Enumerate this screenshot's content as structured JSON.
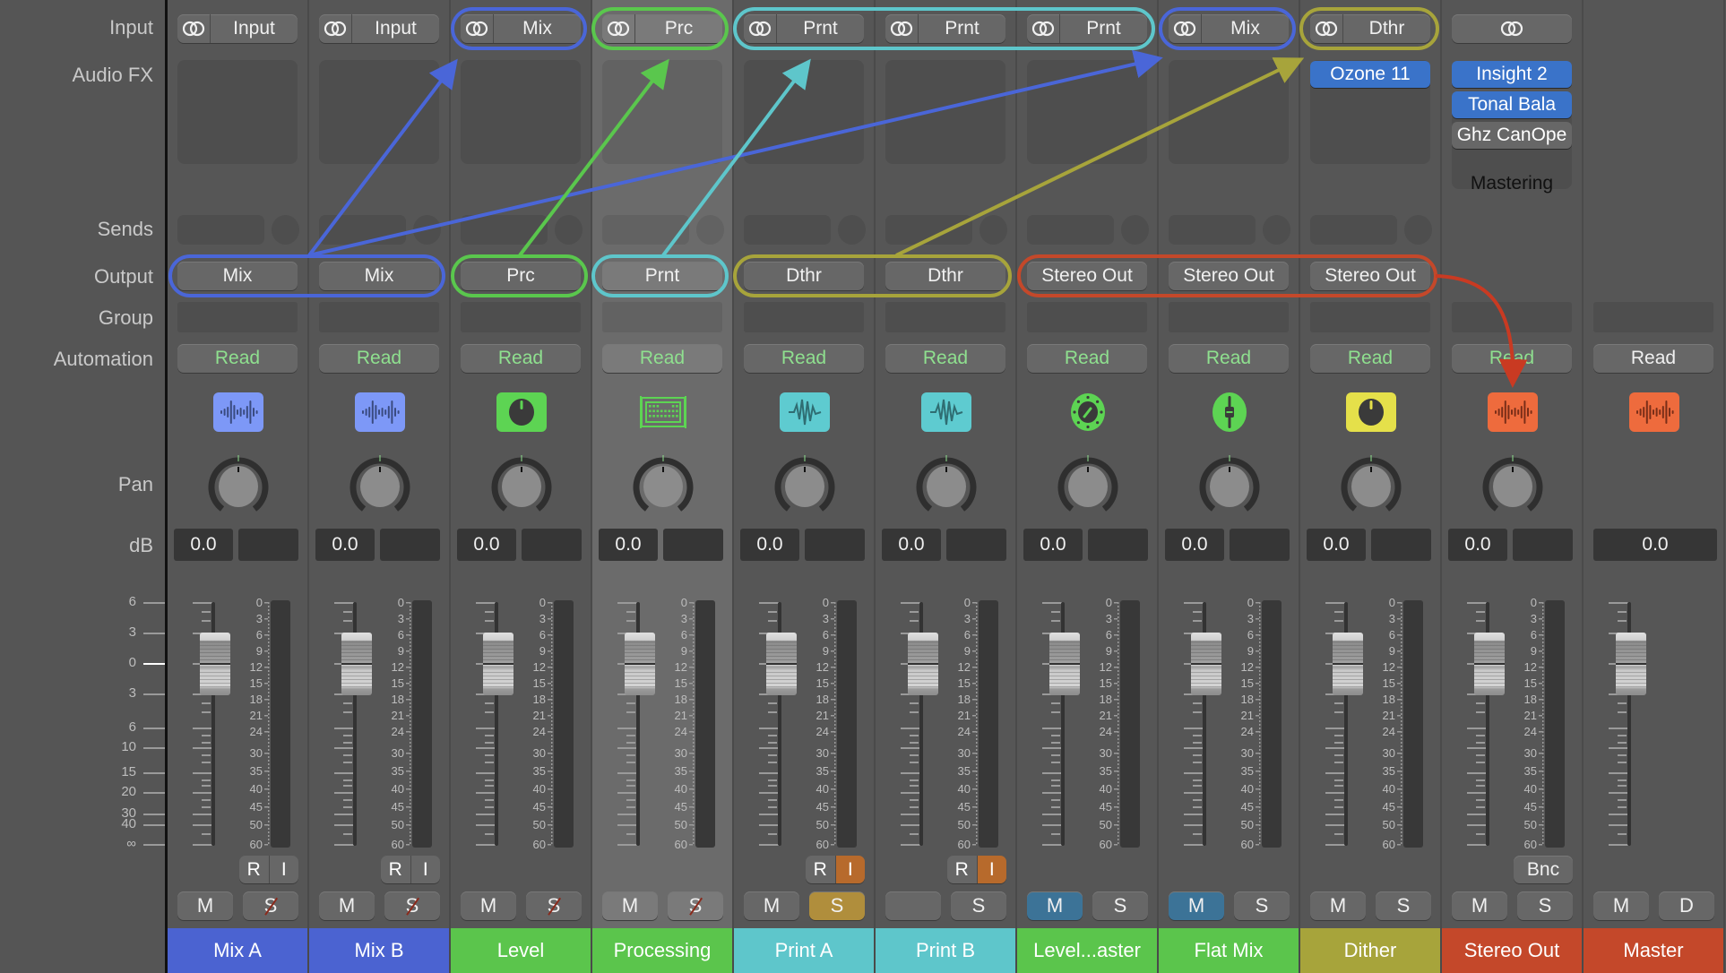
{
  "row_labels": {
    "input": "Input",
    "audio_fx": "Audio FX",
    "sends": "Sends",
    "output": "Output",
    "group": "Group",
    "automation": "Automation",
    "pan": "Pan",
    "db": "dB"
  },
  "fader_scale_left": [
    "6",
    "3",
    "0",
    "3",
    "6",
    "10",
    "15",
    "20",
    "30",
    "40",
    "∞"
  ],
  "meter_scale": [
    "0",
    "3",
    "6",
    "9",
    "12",
    "15",
    "18",
    "21",
    "24",
    "30",
    "35",
    "40",
    "45",
    "50",
    "60"
  ],
  "colors": {
    "blue": "#4a66d8",
    "green": "#5ac74d",
    "cyan": "#5ec6cb",
    "olive": "#a7a43b",
    "red": "#c4482a",
    "plugin_blue": "#3a73c9",
    "read_green": "#8fe08f",
    "mute_on": "#3c7397",
    "solo_on": "#b08e3c",
    "input_on": "#b76a2c"
  },
  "strips": [
    {
      "name": "Mix A",
      "color": "#4b63d1",
      "input": "Input",
      "output": "Mix",
      "automation": "Read",
      "icon": "waveform-icon",
      "icon_color": "#7d98f7",
      "db": "0.0",
      "ri": true,
      "i_on": false,
      "m": "M",
      "s": "S",
      "s_strike": true,
      "m_on": false,
      "s_on": false,
      "plugins": []
    },
    {
      "name": "Mix B",
      "color": "#4b63d1",
      "input": "Input",
      "output": "Mix",
      "automation": "Read",
      "icon": "waveform-icon",
      "icon_color": "#7d98f7",
      "db": "0.0",
      "ri": true,
      "i_on": false,
      "m": "M",
      "s": "S",
      "s_strike": true,
      "m_on": false,
      "s_on": false,
      "plugins": []
    },
    {
      "name": "Level",
      "color": "#5bc54c",
      "input": "Mix",
      "output": "Prc",
      "automation": "Read",
      "icon": "knob-icon",
      "icon_color": "#5dd453",
      "db": "0.0",
      "ri": false,
      "m": "M",
      "s": "S",
      "s_strike": true,
      "m_on": false,
      "s_on": false,
      "plugins": []
    },
    {
      "name": "Processing",
      "color": "#5bc54c",
      "input": "Prc",
      "output": "Prnt",
      "automation": "Read",
      "icon": "keyboard-icon",
      "icon_color": "#5dd453",
      "db": "0.0",
      "ri": false,
      "m": "M",
      "s": "S",
      "s_strike": true,
      "m_on": false,
      "s_on": false,
      "selected": true,
      "plugins": []
    },
    {
      "name": "Print A",
      "color": "#5ec6cb",
      "input": "Prnt",
      "output": "Dthr",
      "automation": "Read",
      "icon": "oscillation-icon",
      "icon_color": "#5ecbd0",
      "db": "0.0",
      "ri": true,
      "i_on": true,
      "m": "M",
      "s": "S",
      "s_strike": false,
      "m_on": false,
      "s_on": true,
      "plugins": []
    },
    {
      "name": "Print B",
      "color": "#5ec6cb",
      "input": "Prnt",
      "output": "Dthr",
      "automation": "Read",
      "icon": "oscillation-icon",
      "icon_color": "#5ecbd0",
      "db": "0.0",
      "ri": true,
      "i_on": true,
      "m": "",
      "s": "S",
      "s_strike": false,
      "m_on": false,
      "s_on": false,
      "plugins": []
    },
    {
      "name": "Level...aster",
      "color": "#5bc54c",
      "input": "Prnt",
      "output": "Stereo Out",
      "automation": "Read",
      "icon": "dial-icon",
      "icon_color": "#5dd453",
      "db": "0.0",
      "ri": false,
      "m": "M",
      "s": "S",
      "s_strike": false,
      "m_on": true,
      "s_on": false,
      "plugins": []
    },
    {
      "name": "Flat Mix",
      "color": "#5bc54c",
      "input": "Mix",
      "output": "Stereo Out",
      "automation": "Read",
      "icon": "fader-icon",
      "icon_color": "#5dd453",
      "db": "0.0",
      "ri": false,
      "m": "M",
      "s": "S",
      "s_strike": false,
      "m_on": true,
      "s_on": false,
      "plugins": []
    },
    {
      "name": "Dither",
      "color": "#a7a43b",
      "input": "Dthr",
      "output": "Stereo Out",
      "automation": "Read",
      "icon": "knob-icon",
      "icon_color": "#e5e04a",
      "db": "0.0",
      "ri": false,
      "m": "M",
      "s": "S",
      "s_strike": false,
      "m_on": false,
      "s_on": false,
      "plugins": [
        {
          "label": "Ozone 11",
          "active": true
        }
      ]
    },
    {
      "name": "Stereo Out",
      "color": "#c4482a",
      "input": "",
      "output": "",
      "automation": "Read",
      "icon": "waveform-icon",
      "icon_color": "#ee6b3d",
      "db": "0.0",
      "ri": false,
      "bnc": "Bnc",
      "m": "M",
      "s": "S",
      "s_strike": false,
      "m_on": false,
      "s_on": false,
      "plugins": [
        {
          "label": "Insight 2",
          "active": true
        },
        {
          "label": "Tonal Bala",
          "active": true
        },
        {
          "label": "Ghz CanOpe",
          "active": false
        }
      ],
      "setting": "Mastering"
    },
    {
      "name": "Master",
      "color": "#c4482a",
      "automation": "Read",
      "automation_white": true,
      "icon": "waveform-icon",
      "icon_color": "#ee6b3d",
      "db": "0.0",
      "ri": false,
      "m": "M",
      "s": "D",
      "s_strike": false,
      "m_on": false,
      "s_on": false,
      "master": true,
      "plugins": []
    }
  ],
  "routing": [
    {
      "from": "Mix A / Mix B output",
      "to": "Level input",
      "color": "#4a66d8"
    },
    {
      "from": "Mix A / Mix B output",
      "to": "Flat Mix input",
      "color": "#4a66d8"
    },
    {
      "from": "Level output",
      "to": "Processing input",
      "color": "#5ac74d"
    },
    {
      "from": "Processing output",
      "to": "Print A/B, Level...aster input",
      "color": "#5ec6cb"
    },
    {
      "from": "Print A / Print B output",
      "to": "Dither input",
      "color": "#a7a43b"
    },
    {
      "from": "Level...aster / Flat Mix / Dither output",
      "to": "Stereo Out",
      "color": "#c4482a"
    }
  ]
}
